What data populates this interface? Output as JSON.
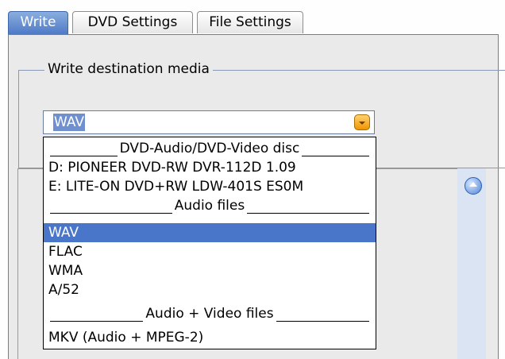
{
  "tabs": [
    {
      "label": "Write",
      "active": true
    },
    {
      "label": "DVD Settings",
      "active": false
    },
    {
      "label": "File Settings",
      "active": false
    }
  ],
  "group": {
    "title": "Write destination media"
  },
  "combo": {
    "value": "WAV"
  },
  "dropdown": {
    "items": [
      {
        "label": "DVD-Audio/DVD-Video disc",
        "kind": "header"
      },
      {
        "label": "D: PIONEER  DVD-RW  DVR-112D 1.09",
        "kind": "option"
      },
      {
        "label": "E: LITE-ON  DVD+RW LDW-401S  ES0M",
        "kind": "option"
      },
      {
        "label": "Audio files",
        "kind": "header"
      },
      {
        "label": "WAV",
        "kind": "option",
        "selected": true
      },
      {
        "label": "FLAC",
        "kind": "option"
      },
      {
        "label": "WMA",
        "kind": "option"
      },
      {
        "label": "A/52",
        "kind": "option"
      },
      {
        "label": "Audio + Video files",
        "kind": "header"
      },
      {
        "label": "MKV (Audio + MPEG-2)",
        "kind": "option"
      }
    ]
  },
  "icons": {
    "combo_arrow": "chevron-down-icon",
    "scroll_up": "scroll-up-icon"
  },
  "colors": {
    "accent": "#4a76c9",
    "combo_arrow": "#f19500"
  }
}
